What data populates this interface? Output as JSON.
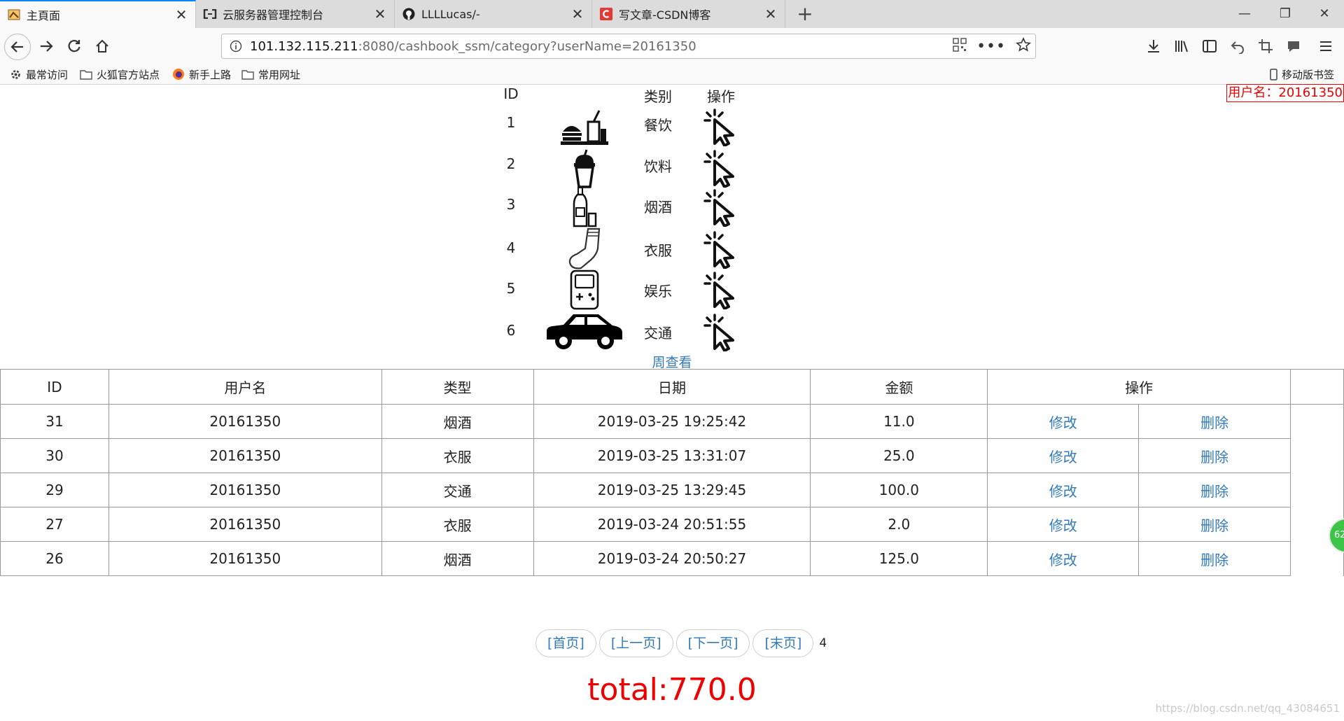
{
  "browser": {
    "tabs": [
      {
        "title": "主頁面",
        "icon": "page-icon"
      },
      {
        "title": "云服务器管理控制台",
        "icon": "aliyun-icon"
      },
      {
        "title": "LLLLucas/-",
        "icon": "github-icon"
      },
      {
        "title": "写文章-CSDN博客",
        "icon": "csdn-icon"
      }
    ],
    "url_host": "101.132.115.211",
    "url_rest": ":8080/cashbook_ssm/category?userName=20161350",
    "bookmarks": [
      "最常访问",
      "火狐官方站点",
      "新手上路",
      "常用网址"
    ],
    "mobile_bookmarks": "移动版书签"
  },
  "page": {
    "user_label": "用户名：20161350",
    "categories_header": {
      "id": "ID",
      "name": "类别",
      "op": "操作"
    },
    "categories": [
      {
        "id": "1",
        "name": "餐饮",
        "icon": "fastfood-icon"
      },
      {
        "id": "2",
        "name": "饮料",
        "icon": "drink-cup-icon"
      },
      {
        "id": "3",
        "name": "烟酒",
        "icon": "bottle-icon"
      },
      {
        "id": "4",
        "name": "衣服",
        "icon": "sock-icon"
      },
      {
        "id": "5",
        "name": "娱乐",
        "icon": "gameboy-icon"
      },
      {
        "id": "6",
        "name": "交通",
        "icon": "car-icon"
      }
    ],
    "week_link": "周查看",
    "table_headers": [
      "ID",
      "用户名",
      "类型",
      "日期",
      "金额",
      "操作"
    ],
    "records": [
      {
        "id": "31",
        "user": "20161350",
        "type": "烟酒",
        "date": "2019-03-25 19:25:42",
        "amount": "11.0",
        "edit": "修改",
        "del": "删除"
      },
      {
        "id": "30",
        "user": "20161350",
        "type": "衣服",
        "date": "2019-03-25 13:31:07",
        "amount": "25.0",
        "edit": "修改",
        "del": "删除"
      },
      {
        "id": "29",
        "user": "20161350",
        "type": "交通",
        "date": "2019-03-25 13:29:45",
        "amount": "100.0",
        "edit": "修改",
        "del": "删除"
      },
      {
        "id": "27",
        "user": "20161350",
        "type": "衣服",
        "date": "2019-03-24 20:51:55",
        "amount": "2.0",
        "edit": "修改",
        "del": "删除"
      },
      {
        "id": "26",
        "user": "20161350",
        "type": "烟酒",
        "date": "2019-03-24 20:50:27",
        "amount": "125.0",
        "edit": "修改",
        "del": "删除"
      }
    ],
    "pager": {
      "first": "[首页]",
      "prev": "[上一页]",
      "next": "[下一页]",
      "last": "[末页]",
      "pages": "4"
    },
    "total": "total:770.0",
    "watermark": "https://blog.csdn.net/qq_43084651",
    "side_badge": "62"
  }
}
